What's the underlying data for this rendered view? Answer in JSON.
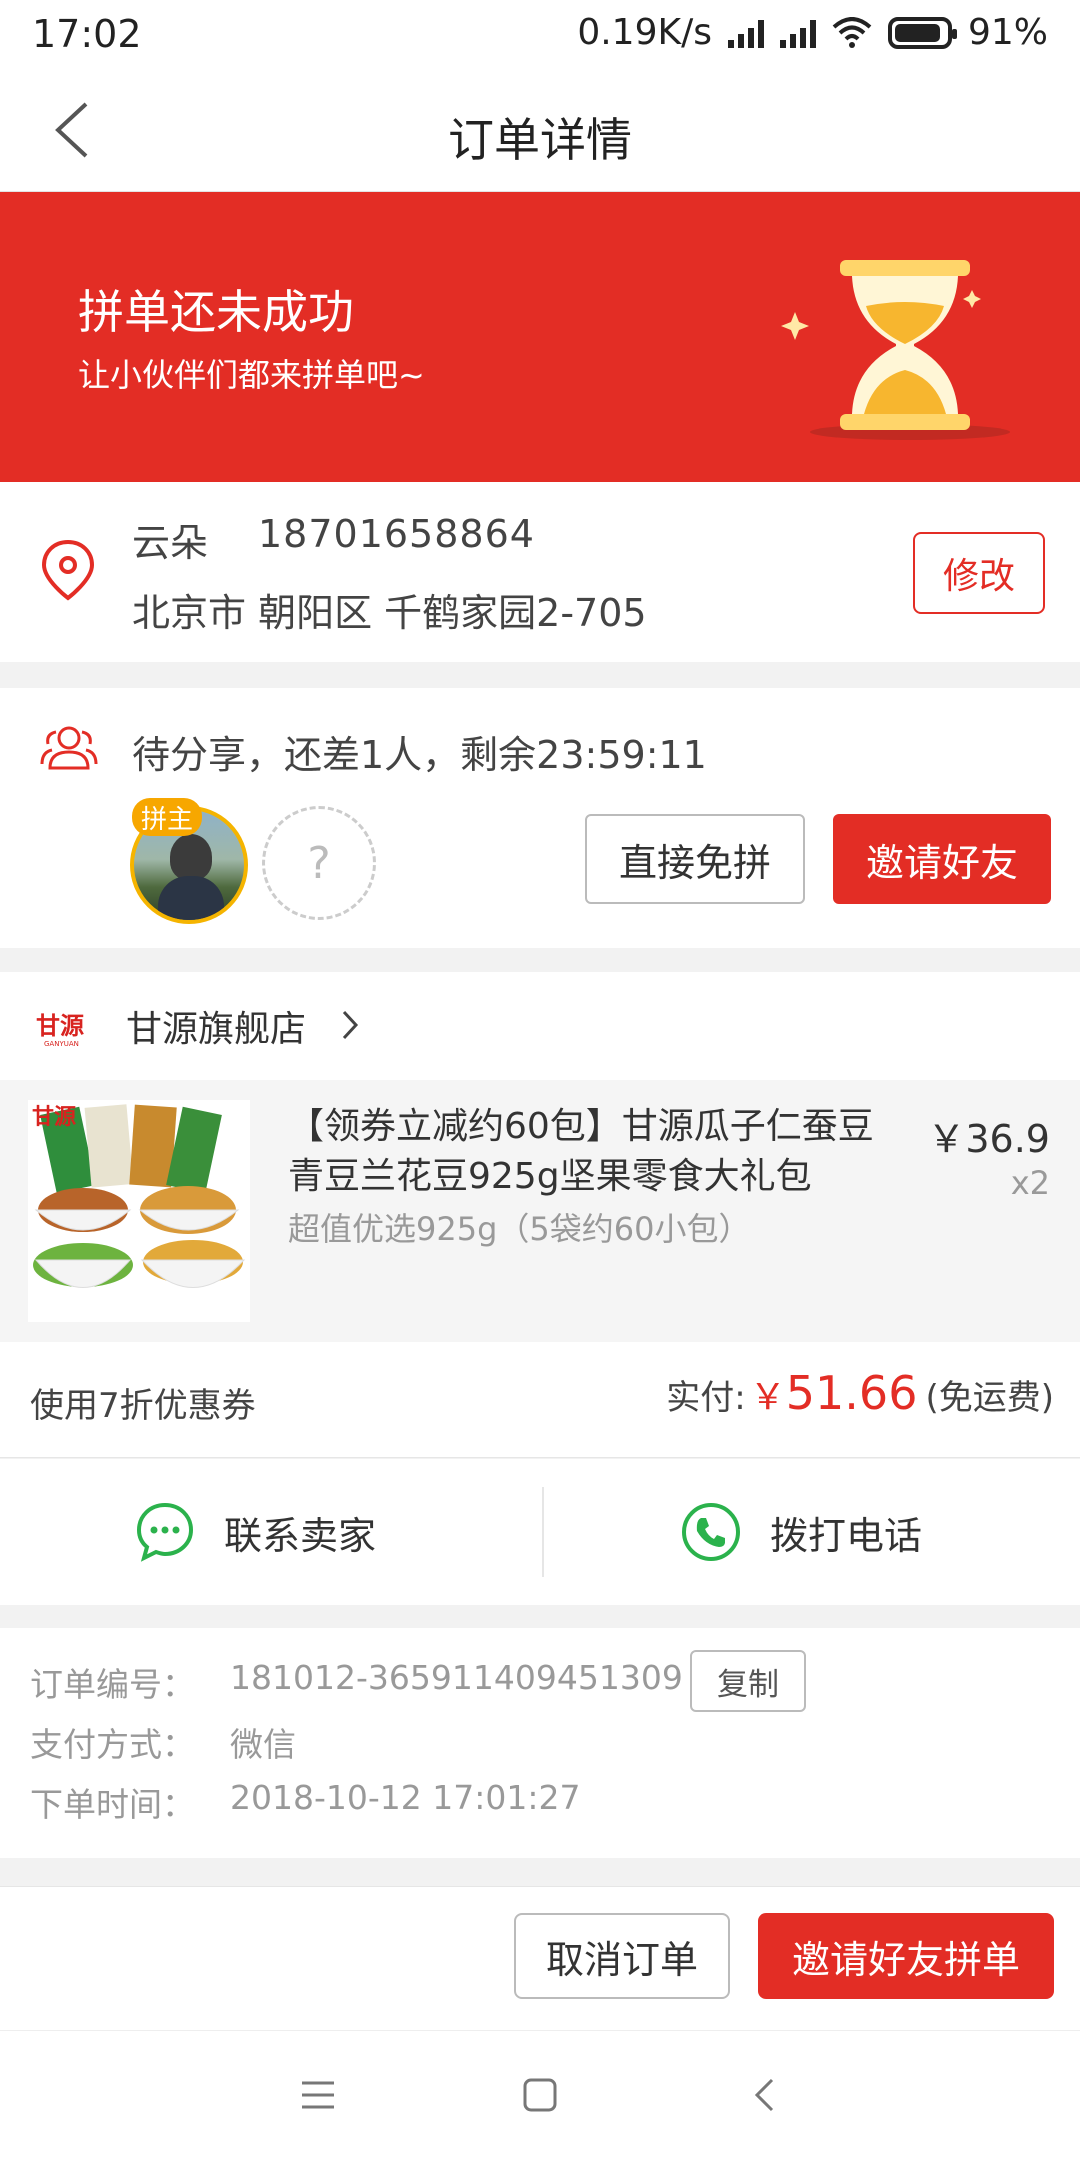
{
  "status_bar": {
    "time": "17:02",
    "speed": "0.19K/s",
    "battery": "91%",
    "battery_level": 0.91
  },
  "nav": {
    "title": "订单详情"
  },
  "banner": {
    "title": "拼单还未成功",
    "subtitle": "让小伙伴们都来拼单吧~",
    "bg_color": "#e32d25"
  },
  "address": {
    "name": "云朵",
    "phone": "18701658864",
    "line": "北京市 朝阳区 千鹤家园2-705",
    "edit_label": "修改"
  },
  "group": {
    "status": "待分享，还差1人，剩余23:59:11",
    "owner_badge": "拼主",
    "empty_slot": "?",
    "free_button": "直接免拼",
    "invite_button": "邀请好友"
  },
  "shop": {
    "logo_text": "甘源",
    "name": "甘源旗舰店"
  },
  "product": {
    "image_logo": "甘源",
    "title": "【领券立减约60包】甘源瓜子仁蚕豆青豆兰花豆925g坚果零食大礼包",
    "spec": "超值优选925g（5袋约60小包）",
    "price": "￥36.9",
    "quantity": "x2"
  },
  "payment": {
    "coupon": "使用7折优惠券",
    "paid_label": "实付:",
    "currency": "￥",
    "amount": "51.66",
    "shipping": "(免运费)"
  },
  "contact": {
    "seller": "联系卖家",
    "phone": "拨打电话"
  },
  "order_info": {
    "rows": [
      {
        "label": "订单编号：",
        "value": "181012-365911409451309"
      },
      {
        "label": "支付方式：",
        "value": "微信"
      },
      {
        "label": "下单时间：",
        "value": "2018-10-12 17:01:27"
      }
    ],
    "copy_label": "复制"
  },
  "actions": {
    "cancel": "取消订单",
    "invite": "邀请好友拼单"
  },
  "colors": {
    "accent": "#e32d25",
    "green": "#2bb24c",
    "gold": "#f5b400"
  }
}
